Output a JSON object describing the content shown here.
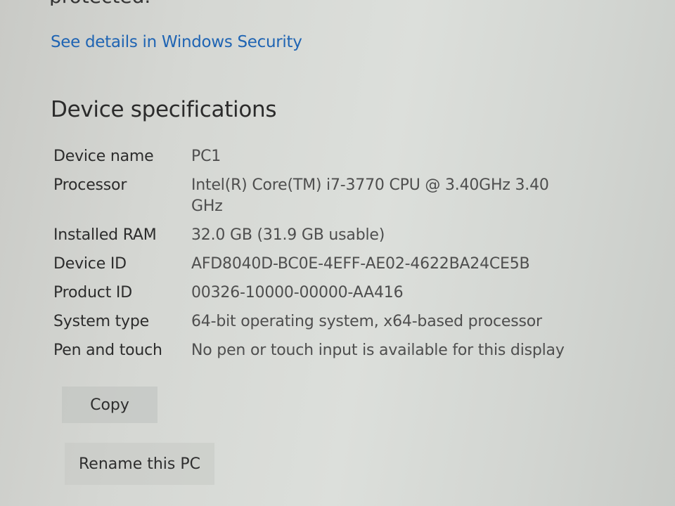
{
  "protection": {
    "heading_cutoff": "protected."
  },
  "security_link": "See details in Windows Security",
  "device_specs": {
    "title": "Device specifications",
    "rows": [
      {
        "label": "Device name",
        "value": "PC1"
      },
      {
        "label": "Processor",
        "value": "Intel(R) Core(TM) i7-3770 CPU @ 3.40GHz   3.40 GHz"
      },
      {
        "label": "Installed RAM",
        "value": "32.0 GB (31.9 GB usable)"
      },
      {
        "label": "Device ID",
        "value": "AFD8040D-BC0E-4EFF-AE02-4622BA24CE5B"
      },
      {
        "label": "Product ID",
        "value": "00326-10000-00000-AA416"
      },
      {
        "label": "System type",
        "value": "64-bit operating system, x64-based processor"
      },
      {
        "label": "Pen and touch",
        "value": "No pen or touch input is available for this display"
      }
    ],
    "copy_label": "Copy"
  },
  "rename_label": "Rename this PC"
}
